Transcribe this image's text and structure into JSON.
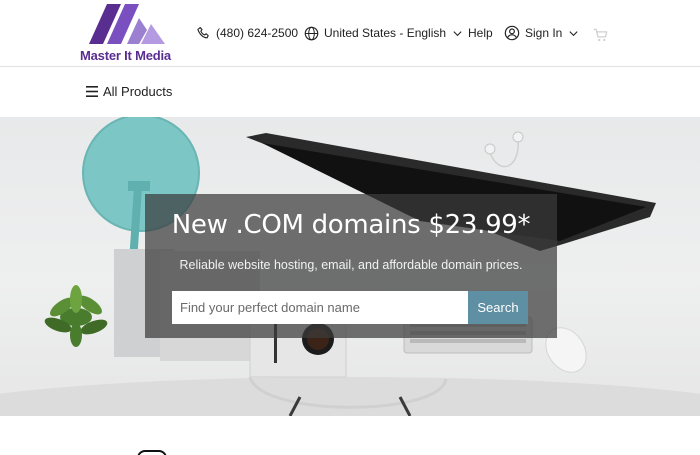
{
  "brand": {
    "name": "Master It Media"
  },
  "header": {
    "phone": "(480) 624-2500",
    "locale": "United States - English",
    "help": "Help",
    "sign_in": "Sign In"
  },
  "subnav": {
    "all_products": "All Products"
  },
  "hero": {
    "headline": "New .COM domains $23.99*",
    "subline": "Reliable website hosting, email, and affordable domain prices.",
    "search_placeholder": "Find your perfect domain name",
    "search_button": "Search"
  },
  "colors": {
    "brand_purple": "#5a2d91",
    "logo_light": "#9b7fd0",
    "search_button": "#5e8fa3",
    "overlay": "#3c3c3c"
  },
  "icons": [
    "phone-icon",
    "globe-icon",
    "chevron-down-icon",
    "user-icon",
    "cart-icon",
    "menu-icon"
  ]
}
